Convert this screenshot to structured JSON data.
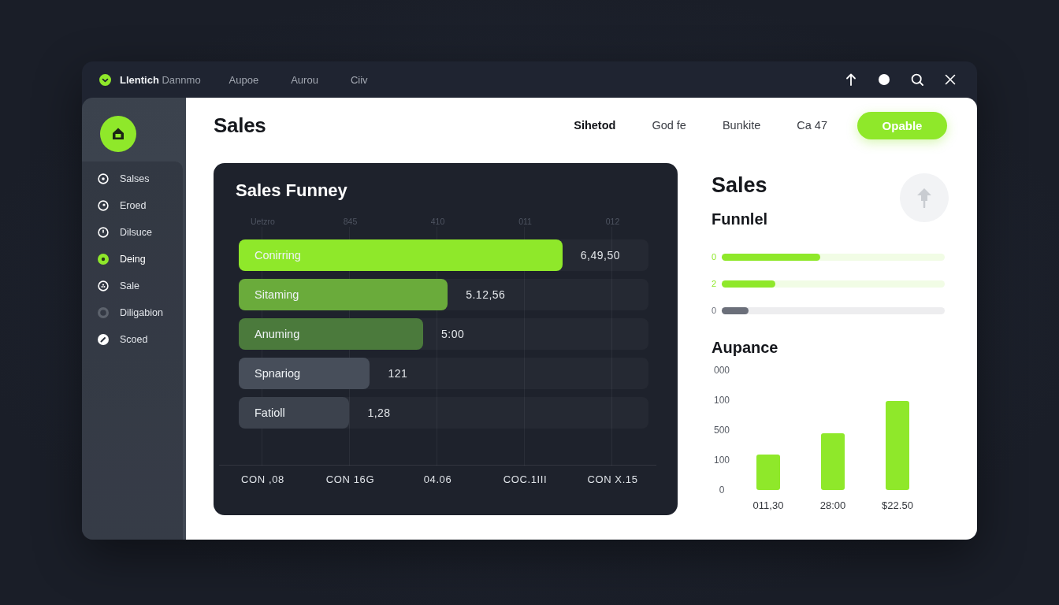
{
  "window": {
    "brand": "Llentich",
    "brand_suffix": "Dannmo",
    "menu": [
      "Aupoe",
      "Aurou",
      "Ciiv"
    ]
  },
  "sidebar": {
    "items": [
      {
        "label": "Salses",
        "selected": false
      },
      {
        "label": "Eroed",
        "selected": false
      },
      {
        "label": "Dilsuce",
        "selected": false
      },
      {
        "label": "Deing",
        "selected": true
      },
      {
        "label": "Sale",
        "selected": false
      },
      {
        "label": "Diligabion",
        "selected": false
      },
      {
        "label": "Scoed",
        "selected": false
      }
    ]
  },
  "header": {
    "title": "Sales",
    "tabs": [
      {
        "label": "Sihetod",
        "selected": true
      },
      {
        "label": "God fe",
        "selected": false
      },
      {
        "label": "Bunkite",
        "selected": false
      },
      {
        "label": "Ca 47",
        "selected": false
      }
    ],
    "button": "Opable"
  },
  "funnel": {
    "title": "Sales Funney",
    "top_labels": [
      "Uetzro",
      "845",
      "410",
      "011",
      "012"
    ],
    "stages": [
      {
        "label": "Conirring",
        "value": "6,49,50",
        "level": 0.79,
        "color": "#8fe82a"
      },
      {
        "label": "Sitaming",
        "value": "5.12,56",
        "level": 0.51,
        "color": "#6aab3b"
      },
      {
        "label": "Anuming",
        "value": "5:00",
        "level": 0.45,
        "color": "#4b7a3c"
      },
      {
        "label": "Spnariog",
        "value": "121",
        "level": 0.32,
        "color": "#474e5a"
      },
      {
        "label": "Fatioll",
        "value": "1,28",
        "level": 0.27,
        "color": "#3c424d"
      }
    ],
    "bottom_labels": [
      "CON ,08",
      "CON 16G",
      "04.06",
      "COC.1III",
      "CON X.15"
    ]
  },
  "side_panel": {
    "title": "Sales",
    "subtitle": "Funnlel",
    "progress": [
      {
        "label": "0",
        "level": 0.44,
        "color": "#8fe82a"
      },
      {
        "label": "2",
        "level": 0.24,
        "color": "#8fe82a"
      },
      {
        "label": "0",
        "level": 0.12,
        "color": "#6b6f7a"
      }
    ],
    "chart_title": "Aupance",
    "chart_y_labels": [
      "000",
      "100",
      "500",
      "100",
      "0"
    ],
    "chart_x_labels": [
      "011,30",
      "28:00",
      "$22.50"
    ]
  }
}
